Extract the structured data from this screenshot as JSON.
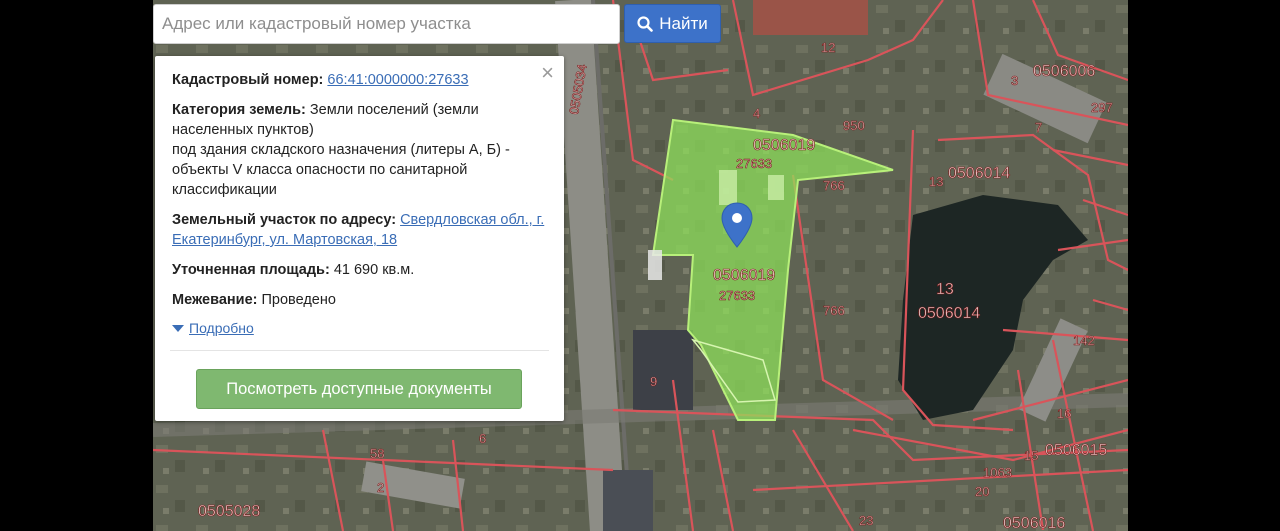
{
  "search": {
    "placeholder": "Адрес или кадастровый номер участка",
    "button_label": "Найти"
  },
  "popup": {
    "cadastral_label": "Кадастровый номер:",
    "cadastral_value": "66:41:0000000:27633",
    "category_label": "Категория земель:",
    "category_value": "Земли поселений (земли населенных пунктов)",
    "category_usage": "под здания складского назначения (литеры А, Б) - объекты V класса опасности по санитарной классификации",
    "address_label": "Земельный участок по адресу:",
    "address_value": "Свердловская обл., г. Екатеринбург, ул. Мартовская, 18",
    "area_label": "Уточненная площадь:",
    "area_value": "41 690 кв.м.",
    "survey_label": "Межевание:",
    "survey_value": "Проведено",
    "more_label": "Подробно",
    "docs_button": "Посмотреть доступные документы",
    "close_symbol": "×"
  },
  "map": {
    "labels": {
      "q_0506019_top": "0506019",
      "plot_27633_top": "27633",
      "q_0506019_mid": "0506019",
      "plot_27633_mid": "27633",
      "q_0506014_top": "0506014",
      "q_0506014_mid": "0506014",
      "n13_lake": "13",
      "n13_right": "13",
      "q_0506006": "0506006",
      "q_0506015": "0506015",
      "q_0506016": "0506016",
      "q_0505028": "0505028",
      "q_0505034": "0505034",
      "n950": "950",
      "n766a": "766",
      "n766b": "766",
      "n12": "12",
      "n4": "4",
      "n3": "3",
      "n7": "7",
      "n9": "9",
      "n6": "6",
      "n2": "2",
      "n58": "58",
      "n142": "142",
      "n23": "23",
      "n20": "20",
      "n1063": "1063",
      "n297": "297",
      "n15": "15",
      "n16": "16"
    }
  },
  "colors": {
    "selected_plot": "#8fe35a",
    "boundary": "#d9545a",
    "search_button": "#3d72c9",
    "docs_button": "#7fb870",
    "link": "#3a6db6"
  }
}
